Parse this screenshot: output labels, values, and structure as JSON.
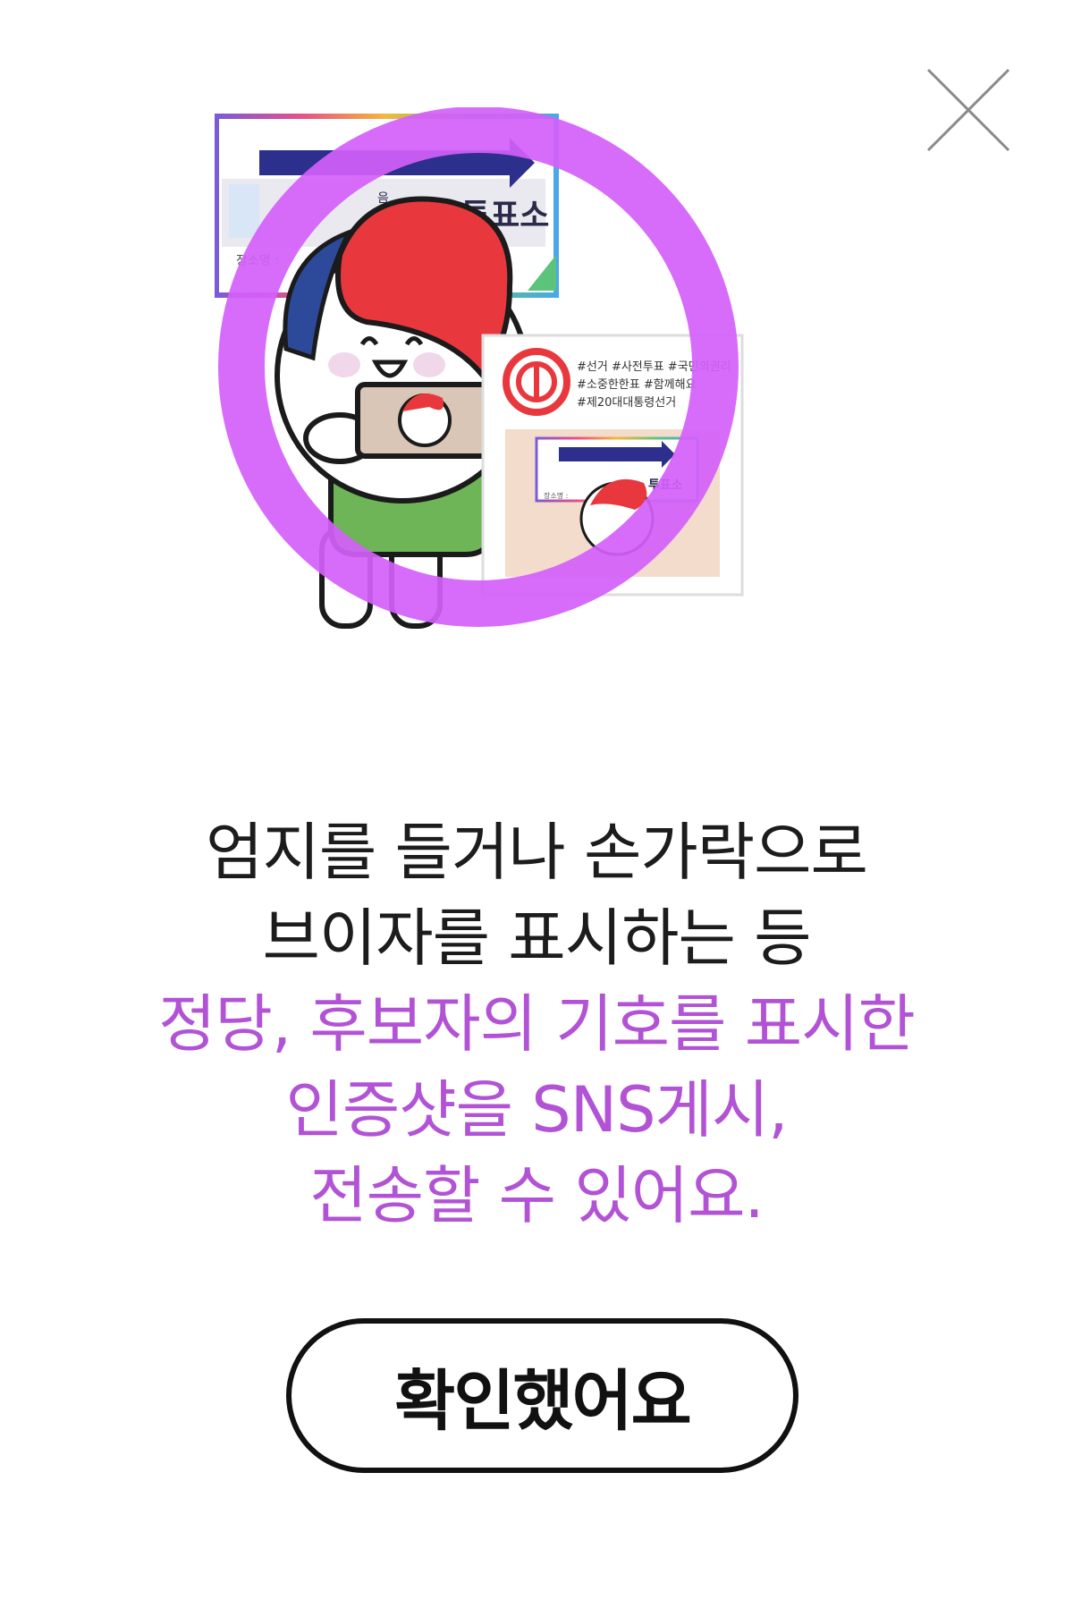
{
  "dialog": {
    "close_icon": "close-icon",
    "illustration": {
      "sign_text": "투표소",
      "sign_fragment": "음",
      "place_label": "장소명 :",
      "hashtags": [
        "#선거 #사전투표 #국민의권리",
        "#소중한한표 #함께해요",
        "#제20대대통령선거"
      ],
      "mini_sign_text": "투표소",
      "mini_place_label": "장소명 :",
      "colors": {
        "prohibit_ring": "#d45ffa",
        "hair": "#e8383d",
        "hair_back": "#2d4a9a",
        "shirt": "#6db556",
        "arrow": "#2c2f8c",
        "stamp": "#e8383d"
      }
    },
    "message": {
      "lines": [
        {
          "text": "엄지를 들거나 손가락으로",
          "tone": "dark"
        },
        {
          "text": "브이자를 표시하는 등",
          "tone": "dark"
        },
        {
          "text": "정당, 후보자의 기호를 표시한",
          "tone": "accent"
        },
        {
          "text": "인증샷을 SNS게시,",
          "tone": "accent"
        },
        {
          "text": "전송할 수 있어요.",
          "tone": "accent"
        }
      ],
      "colors": {
        "dark": "#1c1c1c",
        "accent": "#b253d6"
      }
    },
    "confirm_label": "확인했어요"
  }
}
